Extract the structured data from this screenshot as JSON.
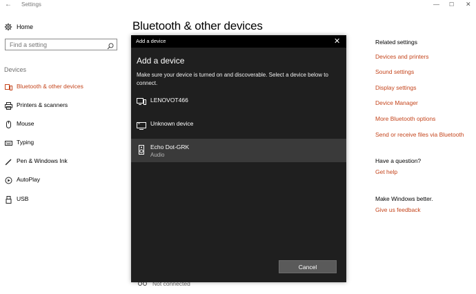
{
  "window": {
    "app_title": "Settings",
    "back_icon": "back-arrow-icon",
    "controls": [
      "minimize",
      "maximize",
      "close"
    ]
  },
  "sidebar": {
    "home_label": "Home",
    "search": {
      "placeholder": "Find a setting",
      "value": ""
    },
    "section": "Devices",
    "items": [
      {
        "label": "Bluetooth & other devices",
        "icon": "bluetooth-devices-icon",
        "active": true
      },
      {
        "label": "Printers & scanners",
        "icon": "printer-icon",
        "active": false
      },
      {
        "label": "Mouse",
        "icon": "mouse-icon",
        "active": false
      },
      {
        "label": "Typing",
        "icon": "keyboard-icon",
        "active": false
      },
      {
        "label": "Pen & Windows Ink",
        "icon": "pen-icon",
        "active": false
      },
      {
        "label": "AutoPlay",
        "icon": "autoplay-icon",
        "active": false
      },
      {
        "label": "USB",
        "icon": "usb-icon",
        "active": false
      }
    ]
  },
  "main": {
    "title": "Bluetooth & other devices",
    "behind_status": "Not connected"
  },
  "related": {
    "heading": "Related settings",
    "links": [
      "Devices and printers",
      "Sound settings",
      "Display settings",
      "Device Manager",
      "More Bluetooth options",
      "Send or receive files via Bluetooth"
    ],
    "question_heading": "Have a question?",
    "question_link": "Get help",
    "better_heading": "Make Windows better.",
    "better_link": "Give us feedback"
  },
  "dialog": {
    "titlebar": "Add a device",
    "heading": "Add a device",
    "description": "Make sure your device is turned on and discoverable. Select a device below to connect.",
    "devices": [
      {
        "name": "LENOVOT466",
        "subtitle": "",
        "icon": "pc-icon",
        "selected": false
      },
      {
        "name": "Unknown device",
        "subtitle": "",
        "icon": "display-icon",
        "selected": false
      },
      {
        "name": "Echo Dot-GRK",
        "subtitle": "Audio",
        "icon": "speaker-icon",
        "selected": true
      }
    ],
    "cancel_label": "Cancel"
  },
  "colors": {
    "accent": "#c4441b",
    "dialog_bg": "#1f1f1f",
    "selected_row": "#3a3a3a"
  }
}
